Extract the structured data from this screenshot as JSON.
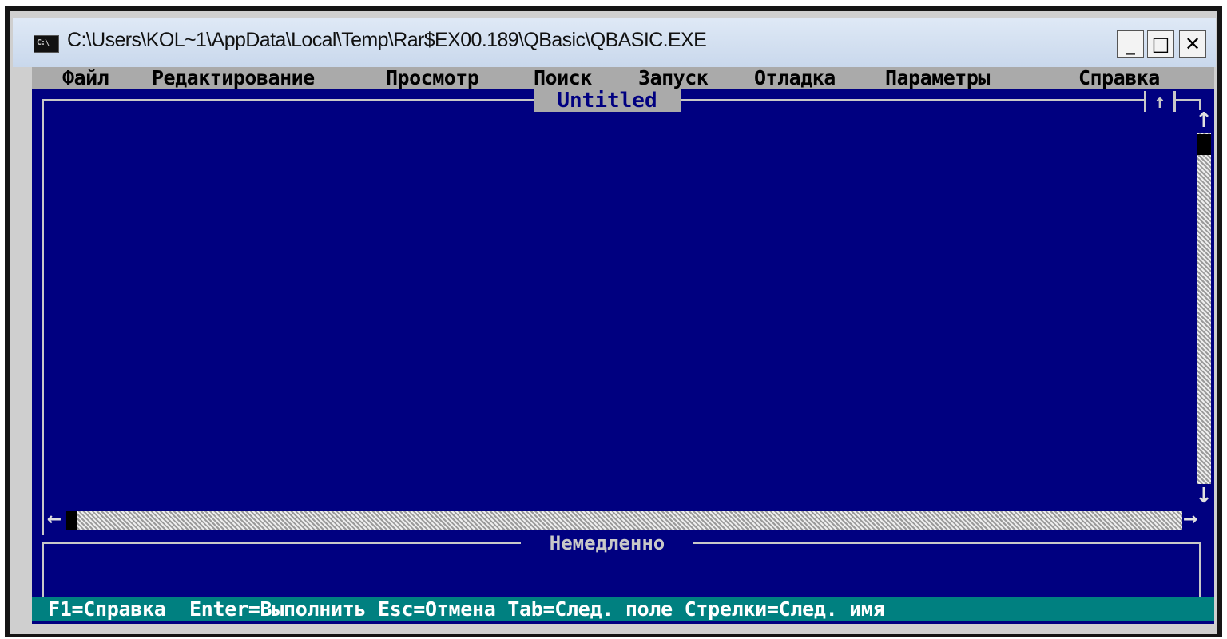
{
  "window": {
    "title": "C:\\Users\\KOL~1\\AppData\\Local\\Temp\\Rar$EX00.189\\QBasic\\QBASIC.EXE",
    "icon_label": "C:\\",
    "minimize_label": "_",
    "maximize_label": "□",
    "close_label": "✕"
  },
  "menu": {
    "items": [
      "Файл",
      "Редактирование",
      "Просмотр",
      "Поиск",
      "Запуск",
      "Отладка",
      "Параметры",
      "Справка"
    ]
  },
  "editor": {
    "title": "Untitled",
    "maximize_arrow": "↑",
    "scroll_up": "↑",
    "scroll_down": "↓",
    "scroll_left": "←",
    "scroll_right": "→"
  },
  "immediate": {
    "title": "Немедленно"
  },
  "statusbar": {
    "text": "F1=Справка  Enter=Выполнить Esc=Отмена Tab=След. поле Стрелки=След. имя"
  },
  "colors": {
    "background": "#000080",
    "menubar": "#aaaaaa",
    "statusbar": "#008080",
    "border": "#c8c8c8"
  }
}
